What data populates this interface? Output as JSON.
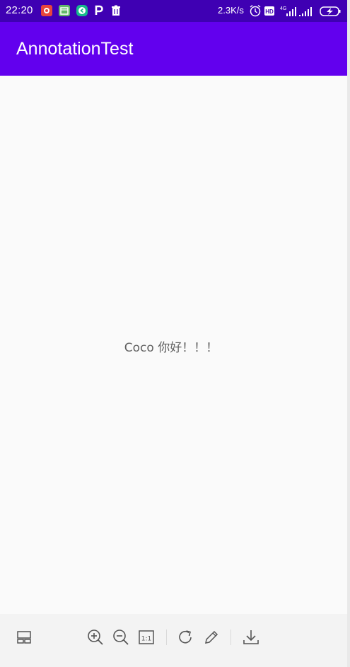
{
  "statusbar": {
    "time": "22:20",
    "net_speed": "2.3K/s",
    "notification_icons": [
      "app-notification-icon",
      "calendar-icon",
      "chat-icon",
      "p-icon",
      "trash-icon"
    ],
    "right_icons": [
      "alarm-icon",
      "hd-icon",
      "signal-4g-icon",
      "signal-icon",
      "battery-charging-icon"
    ]
  },
  "appbar": {
    "title": "AnnotationTest"
  },
  "content": {
    "text": "Coco 你好！！！"
  },
  "toolbar": {
    "buttons": [
      "layout-icon",
      "zoom-in-icon",
      "zoom-out-icon",
      "actual-size-icon",
      "rotate-icon",
      "edit-icon",
      "download-icon"
    ]
  },
  "colors": {
    "statusbar": "#3f00b3",
    "appbar": "#6200ee",
    "background": "#fafafa",
    "toolbar": "#f3f3f3"
  }
}
